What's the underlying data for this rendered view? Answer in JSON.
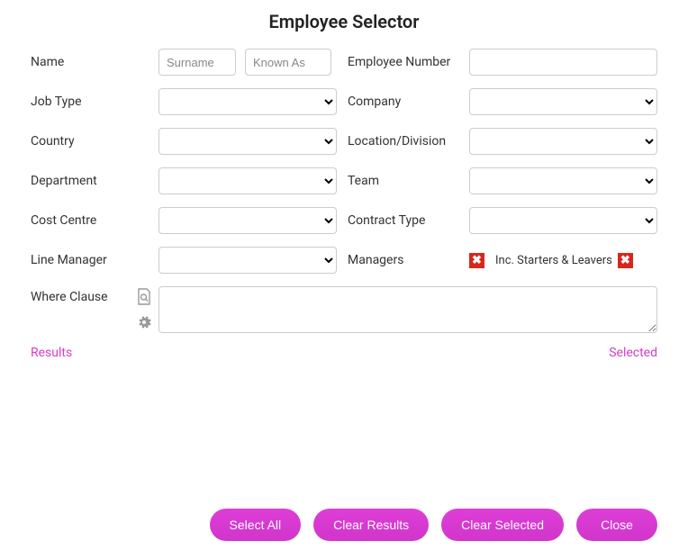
{
  "title": "Employee Selector",
  "labels": {
    "name": "Name",
    "employee_number": "Employee Number",
    "job_type": "Job Type",
    "company": "Company",
    "country": "Country",
    "location_division": "Location/Division",
    "department": "Department",
    "team": "Team",
    "cost_centre": "Cost Centre",
    "contract_type": "Contract Type",
    "line_manager": "Line Manager",
    "managers": "Managers",
    "inc_starters_leavers": "Inc. Starters & Leavers",
    "where_clause": "Where Clause"
  },
  "placeholders": {
    "surname": "Surname",
    "known_as": "Known As"
  },
  "values": {
    "surname": "",
    "known_as": "",
    "employee_number": "",
    "job_type": "",
    "company": "",
    "country": "",
    "location_division": "",
    "department": "",
    "team": "",
    "cost_centre": "",
    "contract_type": "",
    "line_manager": "",
    "managers_checked": false,
    "inc_starters_leavers_checked": false,
    "where_clause": ""
  },
  "tabs": {
    "results": "Results",
    "selected": "Selected"
  },
  "buttons": {
    "select_all": "Select All",
    "clear_results": "Clear Results",
    "clear_selected": "Clear Selected",
    "close": "Close"
  }
}
